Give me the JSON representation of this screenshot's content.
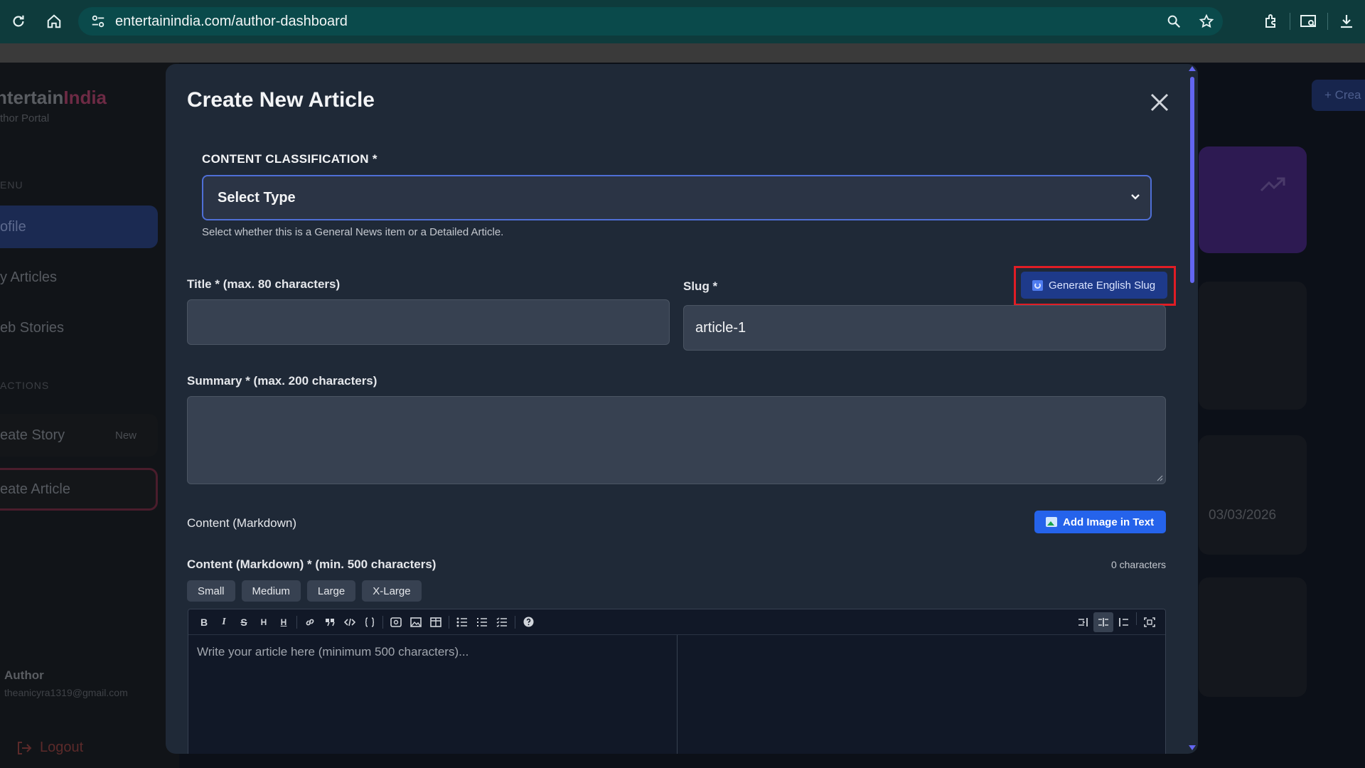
{
  "browser": {
    "url": "entertainindia.com/author-dashboard"
  },
  "sidebar": {
    "brand_prefix": "ntertain",
    "brand_accent": "India",
    "brand_sub": "thor Portal",
    "menu_section": "ENU",
    "items": [
      {
        "label": "ofile"
      },
      {
        "label": "y Articles"
      },
      {
        "label": "eb Stories"
      }
    ],
    "actions_section": "ACTIONS",
    "actions": [
      {
        "label": "eate Story",
        "badge": "New"
      },
      {
        "label": "eate Article"
      }
    ],
    "user_role": "Author",
    "user_email": "theanicyra1319@gmail.com",
    "logout_label": "Logout"
  },
  "background": {
    "create_button": "+ Crea",
    "date": "03/03/2026"
  },
  "modal": {
    "title": "Create New Article",
    "classification_label": "CONTENT CLASSIFICATION *",
    "classification_value": "Select Type",
    "classification_hint": "Select whether this is a General News item or a Detailed Article.",
    "title_label": "Title * (max. 80 characters)",
    "title_value": "",
    "slug_label": "Slug *",
    "slug_button": "Generate English Slug",
    "slug_value": "article-1",
    "summary_label": "Summary * (max. 200 characters)",
    "content_section_label": "Content (Markdown)",
    "add_image_button": "Add Image in Text",
    "content_label": "Content (Markdown) * (min. 500 characters)",
    "char_count": "0 characters",
    "size_buttons": [
      "Small",
      "Medium",
      "Large",
      "X-Large"
    ],
    "editor_placeholder": "Write your article here (minimum 500 characters)...",
    "toolbar": {
      "bold": "B",
      "italic": "I",
      "strike": "S",
      "heading": "H",
      "heading2": "H"
    }
  },
  "colors": {
    "accent": "#2563eb",
    "highlight": "#e11d25",
    "modal_bg": "#1f2937"
  }
}
